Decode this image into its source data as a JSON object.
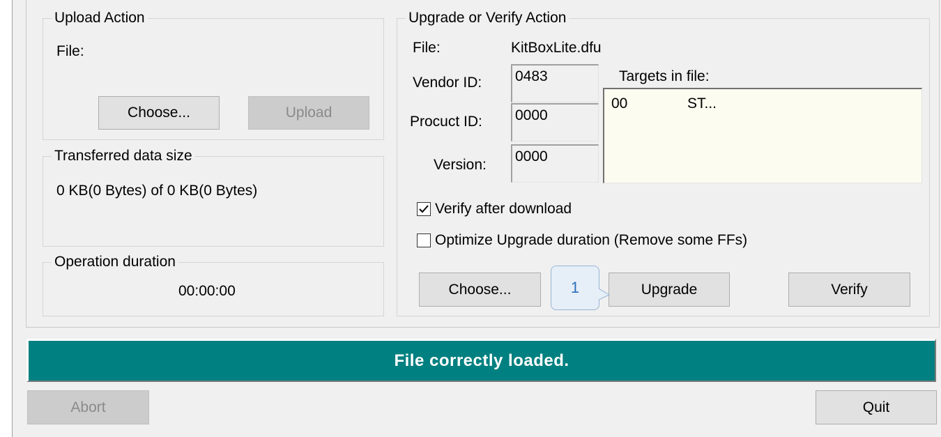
{
  "upload_action": {
    "title": "Upload Action",
    "file_label": "File:",
    "choose_label": "Choose...",
    "upload_label": "Upload"
  },
  "transferred": {
    "title": "Transferred data size",
    "value": "0 KB(0 Bytes) of 0 KB(0 Bytes)"
  },
  "duration": {
    "title": "Operation duration",
    "value": "00:00:00"
  },
  "upgrade_verify": {
    "title": "Upgrade or Verify Action",
    "file_label": "File:",
    "file_value": "KitBoxLite.dfu",
    "vendor_label": "Vendor ID:",
    "vendor_value": "0483",
    "product_label": "Procuct ID:",
    "product_value": "0000",
    "version_label": "Version:",
    "version_value": "0000",
    "targets_label": "Targets in file:",
    "targets": [
      {
        "id": "00",
        "name": "ST..."
      }
    ],
    "verify_after_download": {
      "label": "Verify after download",
      "checked": true
    },
    "optimize_duration": {
      "label": "Optimize Upgrade duration (Remove some FFs)",
      "checked": false
    },
    "choose_label": "Choose...",
    "upgrade_label": "Upgrade",
    "verify_label": "Verify"
  },
  "callout": {
    "number": "1"
  },
  "status": {
    "text": "File correctly loaded.",
    "color": "#008080"
  },
  "footer": {
    "abort_label": "Abort",
    "quit_label": "Quit"
  }
}
